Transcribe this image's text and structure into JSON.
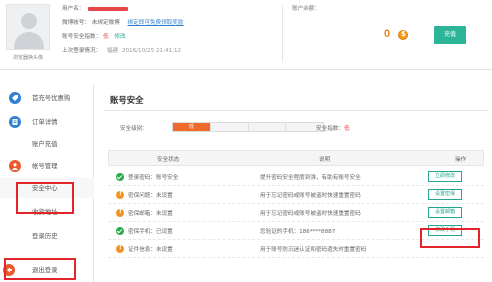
{
  "profile": {
    "avatar_label": "浏览器换头像",
    "username_label": "用户名：",
    "weibo_label": "微博帐号：",
    "weibo_value": "未绑定微博",
    "weibo_link": "绑定即可免费领取奖励",
    "security_label": "账号安全指数：",
    "security_value": "低",
    "security_link": "修改",
    "last_login_label": "上次登录情况：",
    "last_login_location": "福建",
    "last_login_time": "2016/10/25 21:41:12"
  },
  "account": {
    "balance_label": "账户余额：",
    "balance_value": "0",
    "recharge_label": "充值"
  },
  "sidebar": {
    "items": [
      {
        "label": "首充号优惠购",
        "icon": "discount-icon"
      },
      {
        "label": "订单详情",
        "icon": "order-icon"
      },
      {
        "label": "账户充值",
        "icon": ""
      },
      {
        "label": "帐号管理",
        "icon": "user-icon"
      },
      {
        "label": "安全中心",
        "icon": ""
      },
      {
        "label": "收货地址",
        "icon": ""
      },
      {
        "label": "登录历史",
        "icon": ""
      },
      {
        "label": "退出登录",
        "icon": "logout-icon"
      }
    ]
  },
  "main": {
    "title": "账号安全",
    "level_label": "安全级别：",
    "level_seg_low": "低",
    "index_label": "安全指数：",
    "index_value": "低",
    "columns": {
      "status": "安全状态",
      "desc": "说明",
      "op": "操作"
    },
    "rows": [
      {
        "state": "ok",
        "status": "登录密码：账号安全",
        "desc": "提升密码安全程度到强，有助有账号安全",
        "op": "立即修改"
      },
      {
        "state": "warn",
        "status": "密保问题：未设置",
        "desc": "用于忘记密码或账号被盗时快速重置密码",
        "op": "设置密保"
      },
      {
        "state": "warn",
        "status": "密保邮箱：未设置",
        "desc": "用于忘记密码或账号被盗时快速重置密码",
        "op": "设置邮箱"
      },
      {
        "state": "ok",
        "status": "密保手机：已设置",
        "desc": "您验证的手机：186****8887",
        "op": "修改手机"
      },
      {
        "state": "warn",
        "status": "证件信息：未设置",
        "desc": "用于账号防沉迷认证和密码遗失时重置密码",
        "op": ""
      }
    ]
  },
  "colors": {
    "accent_green": "#2bb596",
    "highlight_red": "#e3242b",
    "level_orange": "#ee6b2d",
    "link_blue": "#2f7fcf"
  }
}
